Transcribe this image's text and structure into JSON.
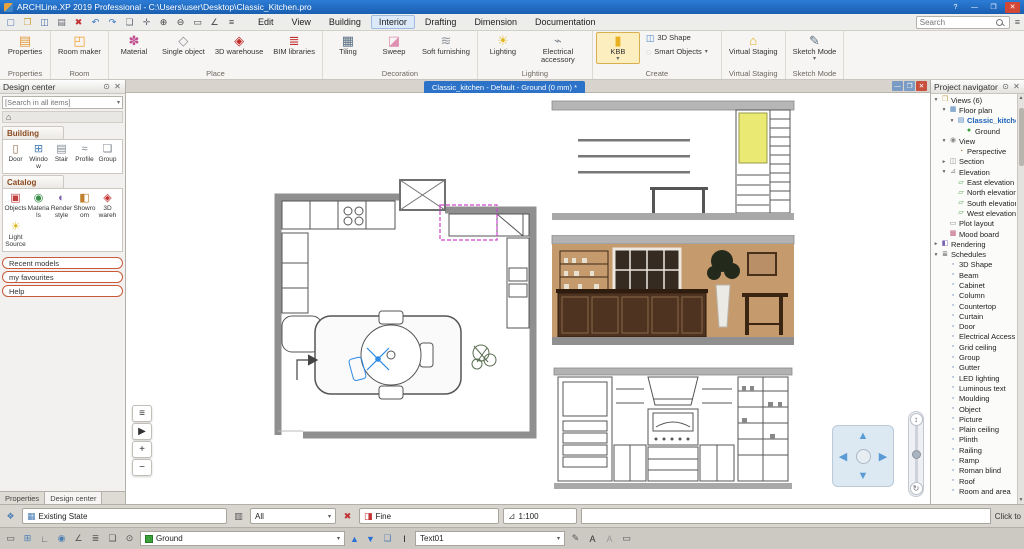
{
  "window": {
    "title": "ARCHLine.XP 2019  Professional - C:\\Users\\user\\Desktop\\Classic_Kitchen.pro"
  },
  "glyphs": {
    "minimize": "—",
    "maximize": "❐",
    "close": "✕",
    "help": "?",
    "pin": "⊙",
    "dropdown": "▾",
    "home": "⌂",
    "up": "▲",
    "down": "▼",
    "left": "◀",
    "right": "▶",
    "list": "≡",
    "play": "▶",
    "plus": "+",
    "minus": "−",
    "pan": "↕",
    "rotate": "↻",
    "scroll_up": "▲",
    "scroll_down": "▼"
  },
  "colors": {
    "accent_blue": "#2b72c8",
    "selection_magenta": "#cc44cc",
    "wall_tan": "#c59a6d",
    "cabinet_yellow": "#e9e973",
    "layer_green": "#3aa03a",
    "close_red": "#d14836"
  },
  "menubar": {
    "items": [
      {
        "label": "Edit"
      },
      {
        "label": "View"
      },
      {
        "label": "Building"
      },
      {
        "label": "Interior",
        "active": true
      },
      {
        "label": "Drafting"
      },
      {
        "label": "Dimension"
      },
      {
        "label": "Documentation"
      }
    ],
    "search_placeholder": "Search"
  },
  "quick_toolbar": {
    "icons": [
      {
        "name": "new-file-icon",
        "glyph": "▢",
        "color": "#5a82b8"
      },
      {
        "name": "open-file-icon",
        "glyph": "❐",
        "color": "#c9a23a"
      },
      {
        "name": "save-icon",
        "glyph": "◫",
        "color": "#4a6fae"
      },
      {
        "name": "print-icon",
        "glyph": "▤",
        "color": "#666677"
      },
      {
        "name": "delete-icon",
        "glyph": "✖",
        "color": "#c23232"
      },
      {
        "name": "undo-icon",
        "glyph": "↶",
        "color": "#2f6fc0"
      },
      {
        "name": "redo-icon",
        "glyph": "↷",
        "color": "#2f6fc0"
      },
      {
        "name": "copy-icon",
        "glyph": "❏",
        "color": "#666677"
      },
      {
        "name": "move-icon",
        "glyph": "✛",
        "color": "#666677"
      },
      {
        "name": "zoom-in-icon",
        "glyph": "⊕",
        "color": "#444444"
      },
      {
        "name": "zoom-out-icon",
        "glyph": "⊖",
        "color": "#444444"
      },
      {
        "name": "zoom-fit-icon",
        "glyph": "▭",
        "color": "#444444"
      },
      {
        "name": "measure-icon",
        "glyph": "∠",
        "color": "#444444"
      },
      {
        "name": "options-icon",
        "glyph": "≡",
        "color": "#444444"
      }
    ]
  },
  "ribbon": {
    "groups": [
      {
        "label": "Properties",
        "buttons": [
          {
            "name": "properties-button",
            "label": "Properties",
            "icon": "▤",
            "color": "#e09a3a"
          }
        ]
      },
      {
        "label": "Room",
        "buttons": [
          {
            "name": "room-maker-button",
            "label": "Room maker",
            "icon": "◰",
            "color": "#f0a030"
          }
        ]
      },
      {
        "label": "Place",
        "buttons": [
          {
            "name": "material-button",
            "label": "Material",
            "icon": "✽",
            "color": "#c05090"
          },
          {
            "name": "single-object-button",
            "label": "Single object",
            "icon": "◇",
            "color": "#8a9098"
          },
          {
            "name": "3d-warehouse-button",
            "label": "3D warehouse",
            "icon": "◈",
            "color": "#c23232"
          },
          {
            "name": "bim-libraries-button",
            "label": "BIM libraries",
            "icon": "≣",
            "color": "#c23232"
          }
        ]
      },
      {
        "label": "Decoration",
        "buttons": [
          {
            "name": "tiling-button",
            "label": "Tiling",
            "icon": "▦",
            "color": "#5a6f82"
          },
          {
            "name": "sweep-button",
            "label": "Sweep",
            "icon": "◪",
            "color": "#e090b0"
          },
          {
            "name": "soft-furnishing-button",
            "label": "Soft furnishing",
            "icon": "≋",
            "color": "#9098a0"
          }
        ]
      },
      {
        "label": "Lighting",
        "buttons": [
          {
            "name": "lighting-button",
            "label": "Lighting",
            "icon": "☀",
            "color": "#e2b61e"
          },
          {
            "name": "electrical-accessory-button",
            "label": "Electrical accessory",
            "icon": "⌁",
            "color": "#80888f"
          }
        ]
      },
      {
        "label": "Create",
        "buttons": [
          {
            "name": "kbb-button",
            "label": "KBB",
            "icon": "▮",
            "color": "#e8b020",
            "dd": "▾",
            "active": true
          },
          {
            "name": "3d-shape-button",
            "label": "3D Shape",
            "icon": "◫",
            "color": "#4a86c8",
            "small": true
          },
          {
            "name": "smart-objects-button",
            "label": "Smart Objects",
            "icon": "◌",
            "color": "#9098a0",
            "small": true,
            "dd": "▾"
          }
        ]
      },
      {
        "label": "Virtual Staging",
        "buttons": [
          {
            "name": "virtual-staging-button",
            "label": "Virtual Staging",
            "icon": "⌂",
            "color": "#e8b020"
          }
        ]
      },
      {
        "label": "Sketch Mode",
        "buttons": [
          {
            "name": "sketch-mode-button",
            "label": "Sketch Mode",
            "icon": "✎",
            "color": "#5a6f82",
            "dd": "▾"
          }
        ]
      }
    ]
  },
  "design_center": {
    "title": "Design center",
    "search_placeholder": "[Search in all items]",
    "building_label": "Building",
    "building_items": [
      {
        "label": "Door",
        "icon": "▯",
        "color": "#8a6a4a"
      },
      {
        "label": "Window",
        "icon": "⊞",
        "color": "#4a7fb5"
      },
      {
        "label": "Stair",
        "icon": "▤",
        "color": "#808890"
      },
      {
        "label": "Profile",
        "icon": "≈",
        "color": "#808890"
      },
      {
        "label": "Group",
        "icon": "❏",
        "color": "#808890"
      }
    ],
    "catalog_label": "Catalog",
    "catalog_items": [
      {
        "label": "Objects",
        "icon": "▣",
        "color": "#c04040"
      },
      {
        "label": "Materials",
        "icon": "◉",
        "color": "#3a8f4a"
      },
      {
        "label": "Render style",
        "icon": "◐",
        "color": "#7a5fae"
      },
      {
        "label": "Showroom",
        "icon": "◧",
        "color": "#c08030"
      },
      {
        "label": "3D wareh",
        "icon": "◈",
        "color": "#c23232"
      },
      {
        "label": "Light Source",
        "icon": "☀",
        "color": "#e2b61e"
      }
    ],
    "links": [
      {
        "label": "Recent models"
      },
      {
        "label": "my favourites"
      },
      {
        "label": "Help"
      }
    ],
    "tabs": [
      {
        "label": "Properties"
      },
      {
        "label": "Design center",
        "active": true
      }
    ]
  },
  "canvas": {
    "tab": "Classic_kitchen - Default - Ground (0 mm) *"
  },
  "project_navigator": {
    "title": "Project navigator",
    "tree": [
      {
        "label": "Views (6)",
        "indent": 0,
        "icon": "❒",
        "color": "#caa24a",
        "arrow": "▾"
      },
      {
        "label": "Floor plan",
        "indent": 1,
        "icon": "▦",
        "color": "#4a7fb5",
        "arrow": "▾"
      },
      {
        "label": "Classic_kitchen",
        "indent": 2,
        "icon": "▤",
        "color": "#4a7fb5",
        "arrow": "▾",
        "active": true
      },
      {
        "label": "Ground",
        "indent": 3,
        "icon": "●",
        "color": "#3aa03a"
      },
      {
        "label": "View",
        "indent": 1,
        "icon": "◉",
        "color": "#8a8a8a",
        "arrow": "▾"
      },
      {
        "label": "Perspective",
        "indent": 2,
        "icon": "◔",
        "color": "#c08030"
      },
      {
        "label": "Section",
        "indent": 1,
        "icon": "◫",
        "color": "#8a8a8a",
        "arrow": "▸"
      },
      {
        "label": "Elevation",
        "indent": 1,
        "icon": "⊿",
        "color": "#8a8a8a",
        "arrow": "▾"
      },
      {
        "label": "East elevation",
        "indent": 2,
        "icon": "▱",
        "color": "#4a9f4a"
      },
      {
        "label": "North elevation",
        "indent": 2,
        "icon": "▱",
        "color": "#4a9f4a"
      },
      {
        "label": "South elevation",
        "indent": 2,
        "icon": "▱",
        "color": "#4a9f4a"
      },
      {
        "label": "West elevation",
        "indent": 2,
        "icon": "▱",
        "color": "#4a9f4a"
      },
      {
        "label": "Plot layout",
        "indent": 1,
        "icon": "▭",
        "color": "#8a8a8a"
      },
      {
        "label": "Mood board",
        "indent": 1,
        "icon": "▩",
        "color": "#c06080"
      },
      {
        "label": "Rendering",
        "indent": 0,
        "icon": "◧",
        "color": "#7a5fae",
        "arrow": "▸"
      },
      {
        "label": "Schedules",
        "indent": 0,
        "icon": "≣",
        "color": "#666666",
        "arrow": "▾"
      },
      {
        "label": "3D Shape",
        "indent": 1,
        "icon": "▫",
        "color": "#6a8ab5"
      },
      {
        "label": "Beam",
        "indent": 1,
        "icon": "▫",
        "color": "#6a8ab5"
      },
      {
        "label": "Cabinet",
        "indent": 1,
        "icon": "▫",
        "color": "#6a8ab5"
      },
      {
        "label": "Column",
        "indent": 1,
        "icon": "▫",
        "color": "#6a8ab5"
      },
      {
        "label": "Countertop",
        "indent": 1,
        "icon": "▫",
        "color": "#6a8ab5"
      },
      {
        "label": "Curtain",
        "indent": 1,
        "icon": "▫",
        "color": "#6a8ab5"
      },
      {
        "label": "Door",
        "indent": 1,
        "icon": "▫",
        "color": "#6a8ab5"
      },
      {
        "label": "Electrical Access",
        "indent": 1,
        "icon": "▫",
        "color": "#6a8ab5"
      },
      {
        "label": "Grid ceiling",
        "indent": 1,
        "icon": "▫",
        "color": "#6a8ab5"
      },
      {
        "label": "Group",
        "indent": 1,
        "icon": "▫",
        "color": "#6a8ab5"
      },
      {
        "label": "Gutter",
        "indent": 1,
        "icon": "▫",
        "color": "#6a8ab5"
      },
      {
        "label": "LED lighting",
        "indent": 1,
        "icon": "▫",
        "color": "#6a8ab5"
      },
      {
        "label": "Luminous text",
        "indent": 1,
        "icon": "▫",
        "color": "#6a8ab5"
      },
      {
        "label": "Moulding",
        "indent": 1,
        "icon": "▫",
        "color": "#6a8ab5"
      },
      {
        "label": "Object",
        "indent": 1,
        "icon": "▫",
        "color": "#6a8ab5"
      },
      {
        "label": "Picture",
        "indent": 1,
        "icon": "▫",
        "color": "#6a8ab5"
      },
      {
        "label": "Plain ceiling",
        "indent": 1,
        "icon": "▫",
        "color": "#6a8ab5"
      },
      {
        "label": "Plinth",
        "indent": 1,
        "icon": "▫",
        "color": "#6a8ab5"
      },
      {
        "label": "Railing",
        "indent": 1,
        "icon": "▫",
        "color": "#6a8ab5"
      },
      {
        "label": "Ramp",
        "indent": 1,
        "icon": "▫",
        "color": "#6a8ab5"
      },
      {
        "label": "Roman blind",
        "indent": 1,
        "icon": "▫",
        "color": "#6a8ab5"
      },
      {
        "label": "Roof",
        "indent": 1,
        "icon": "▫",
        "color": "#6a8ab5"
      },
      {
        "label": "Room and area",
        "indent": 1,
        "icon": "▫",
        "color": "#6a8ab5"
      }
    ]
  },
  "status1": {
    "left_icon": "❖",
    "state_icon": "▦",
    "state_label": "Existing State",
    "filter_icon": "▥",
    "filter_label": "All",
    "fine_pre_icon": "✖",
    "fine_icon": "◨",
    "fine_label": "Fine",
    "scale_icon": "⊿",
    "scale_label": "1:100",
    "input_value": "",
    "hint": "Click to"
  },
  "status2": {
    "icons": [
      {
        "name": "select-mode-icon",
        "glyph": "▭",
        "color": "#555555"
      },
      {
        "name": "grid-icon",
        "glyph": "⊞",
        "color": "#4a7fb5"
      },
      {
        "name": "ortho-icon",
        "glyph": "∟",
        "color": "#555555"
      },
      {
        "name": "snap-icon",
        "glyph": "◉",
        "color": "#4a7fb5"
      },
      {
        "name": "angle-icon",
        "glyph": "∠",
        "color": "#555555"
      },
      {
        "name": "layers-icon",
        "glyph": "≣",
        "color": "#555555"
      },
      {
        "name": "group-icon",
        "glyph": "❏",
        "color": "#555555"
      },
      {
        "name": "magnet-icon",
        "glyph": "⊙",
        "color": "#555555"
      }
    ],
    "layer_value": "Ground",
    "mid_icons": [
      {
        "name": "sheet-icon",
        "glyph": "❏",
        "color": "#4a7fb5"
      },
      {
        "name": "text-cursor-icon",
        "glyph": "I",
        "color": "#222222"
      }
    ],
    "style_value": "Text01",
    "right_icons": [
      {
        "name": "edit-text-icon",
        "glyph": "✎",
        "color": "#555555"
      },
      {
        "name": "text-style-icon",
        "glyph": "A",
        "color": "#333333"
      },
      {
        "name": "text-outline-icon",
        "glyph": "A",
        "color": "#999999"
      },
      {
        "name": "text-frame-icon",
        "glyph": "▭",
        "color": "#555555"
      }
    ]
  }
}
